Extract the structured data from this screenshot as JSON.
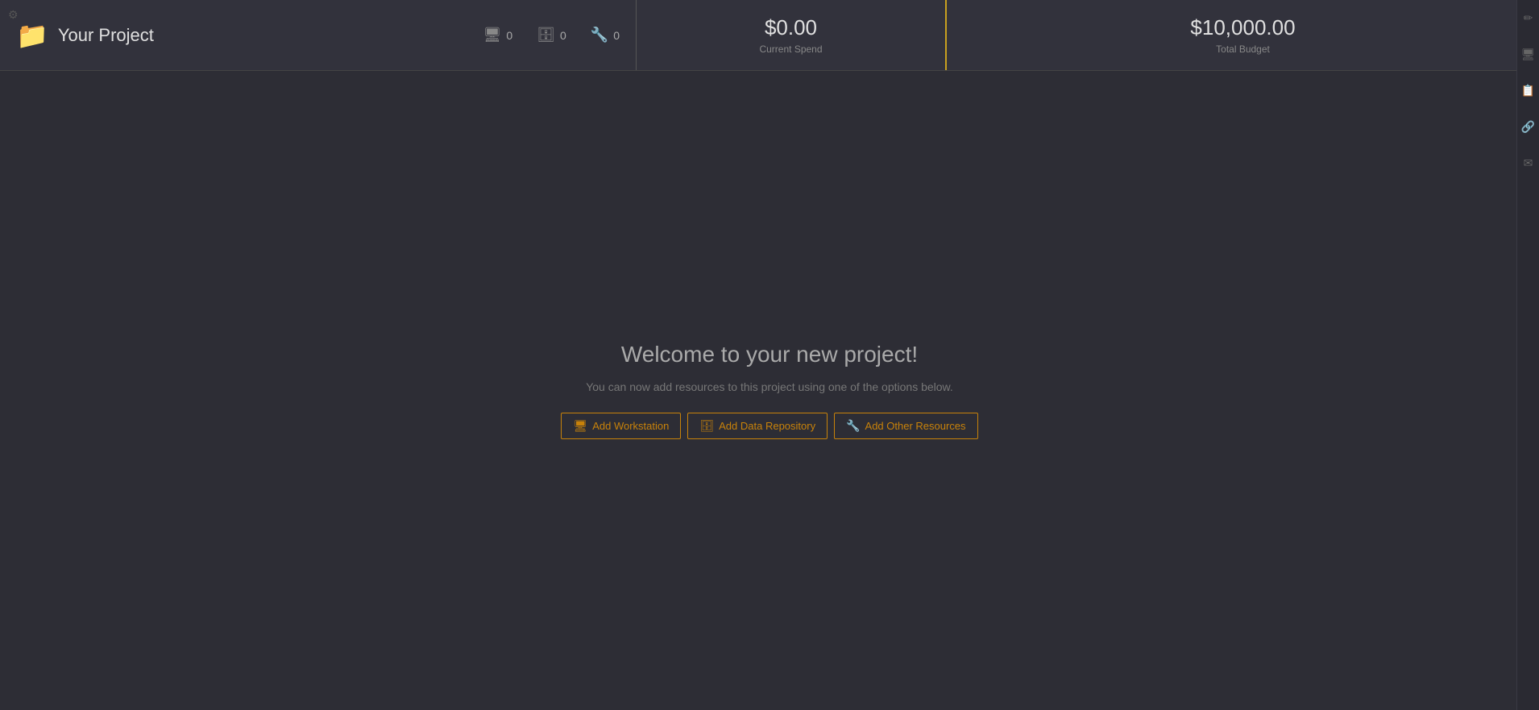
{
  "header": {
    "project_name": "Your Project",
    "folder_icon": "📁",
    "stats": [
      {
        "icon": "🖥",
        "count": "0",
        "id": "workstation-count"
      },
      {
        "icon": "🗄",
        "count": "0",
        "id": "repository-count"
      },
      {
        "icon": "🔧",
        "count": "0",
        "id": "resource-count"
      }
    ],
    "current_spend_label": "Current Spend",
    "current_spend_value": "$0.00",
    "total_budget_label": "Total Budget",
    "total_budget_value": "$10,000.00"
  },
  "main": {
    "welcome_title": "Welcome to your new project!",
    "welcome_subtitle": "You can now add resources to this project using one of the options below.",
    "buttons": [
      {
        "label": "Add Workstation",
        "icon": "🖥"
      },
      {
        "label": "Add Data Repository",
        "icon": "🗄"
      },
      {
        "label": "Add Other Resources",
        "icon": "🔧"
      }
    ]
  },
  "sidebar": {
    "icons": [
      "✏",
      "🖥",
      "📁",
      "⚙",
      "✉"
    ]
  }
}
